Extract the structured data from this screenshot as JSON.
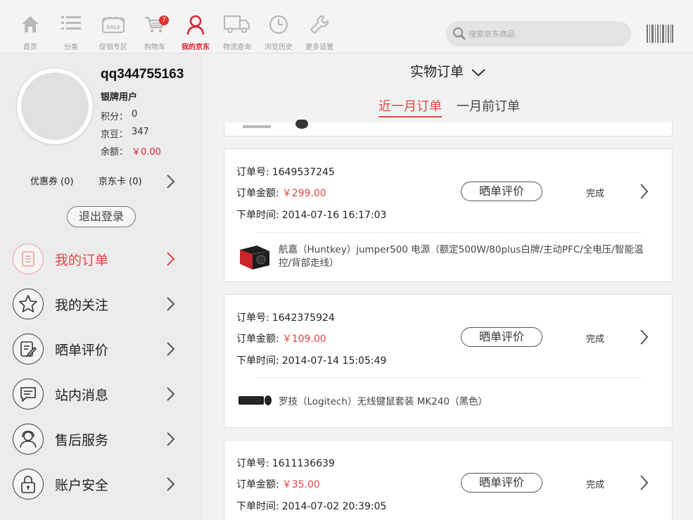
{
  "nav": [
    {
      "key": "home",
      "label": "首页",
      "icon": "home-icon"
    },
    {
      "key": "category",
      "label": "分类",
      "icon": "list-icon"
    },
    {
      "key": "promo",
      "label": "促销专区",
      "icon": "sale-tag-icon"
    },
    {
      "key": "cart",
      "label": "购物车",
      "icon": "cart-icon",
      "badge": "7"
    },
    {
      "key": "myjd",
      "label": "我的京东",
      "icon": "user-icon",
      "active": true
    },
    {
      "key": "logistics",
      "label": "物流查询",
      "icon": "truck-icon"
    },
    {
      "key": "history",
      "label": "浏览历史",
      "icon": "clock-icon"
    },
    {
      "key": "settings",
      "label": "更多设置",
      "icon": "wrench-icon"
    }
  ],
  "search": {
    "placeholder": "搜索京东商品"
  },
  "colors": {
    "accent": "#d9232d",
    "accent_light": "#e04744",
    "bg": "#f2f2f2",
    "sidebar_bg": "#ececec"
  },
  "profile": {
    "username": "qq344755163",
    "level": "银牌用户",
    "points_label": "积分：",
    "points": "0",
    "beans_label": "京豆：",
    "beans": "347",
    "balance_label": "余额：",
    "balance": "￥0.00",
    "coupons": "优惠券 (0)",
    "jdcard": "京东卡 (0)",
    "logout": "退出登录"
  },
  "menu": [
    {
      "label": "我的订单",
      "icon": "order-list-icon",
      "active": true
    },
    {
      "label": "我的关注",
      "icon": "star-icon"
    },
    {
      "label": "晒单评价",
      "icon": "review-edit-icon"
    },
    {
      "label": "站内消息",
      "icon": "message-icon"
    },
    {
      "label": "售后服务",
      "icon": "service-person-icon"
    },
    {
      "label": "账户安全",
      "icon": "lock-icon"
    }
  ],
  "orders_header": {
    "title": "实物订单",
    "tabs": [
      {
        "label": "近一月订单",
        "active": true
      },
      {
        "label": "一月前订单",
        "active": false
      }
    ]
  },
  "orders": [
    {
      "no_label": "订单号:",
      "no": "1649537245",
      "amount_label": "订单金额:",
      "amount": "￥299.00",
      "time_label": "下单时间:",
      "time": "2014-07-16 16:17:03",
      "review": "晒单评价",
      "status": "完成",
      "product": "航嘉（Huntkey）jumper500 电源（额定500W/80plus白牌/主动PFC/全电压/智能温控/背部走线）"
    },
    {
      "no_label": "订单号:",
      "no": "1642375924",
      "amount_label": "订单金额:",
      "amount": "￥109.00",
      "time_label": "下单时间:",
      "time": "2014-07-14 15:05:49",
      "review": "晒单评价",
      "status": "完成",
      "product": "罗技（Logitech）无线键鼠套装 MK240（黑色）"
    },
    {
      "no_label": "订单号:",
      "no": "1611136639",
      "amount_label": "订单金额:",
      "amount": "￥35.00",
      "time_label": "下单时间:",
      "time": "2014-07-02 20:39:05",
      "review": "晒单评价",
      "status": "完成",
      "product": ""
    }
  ]
}
